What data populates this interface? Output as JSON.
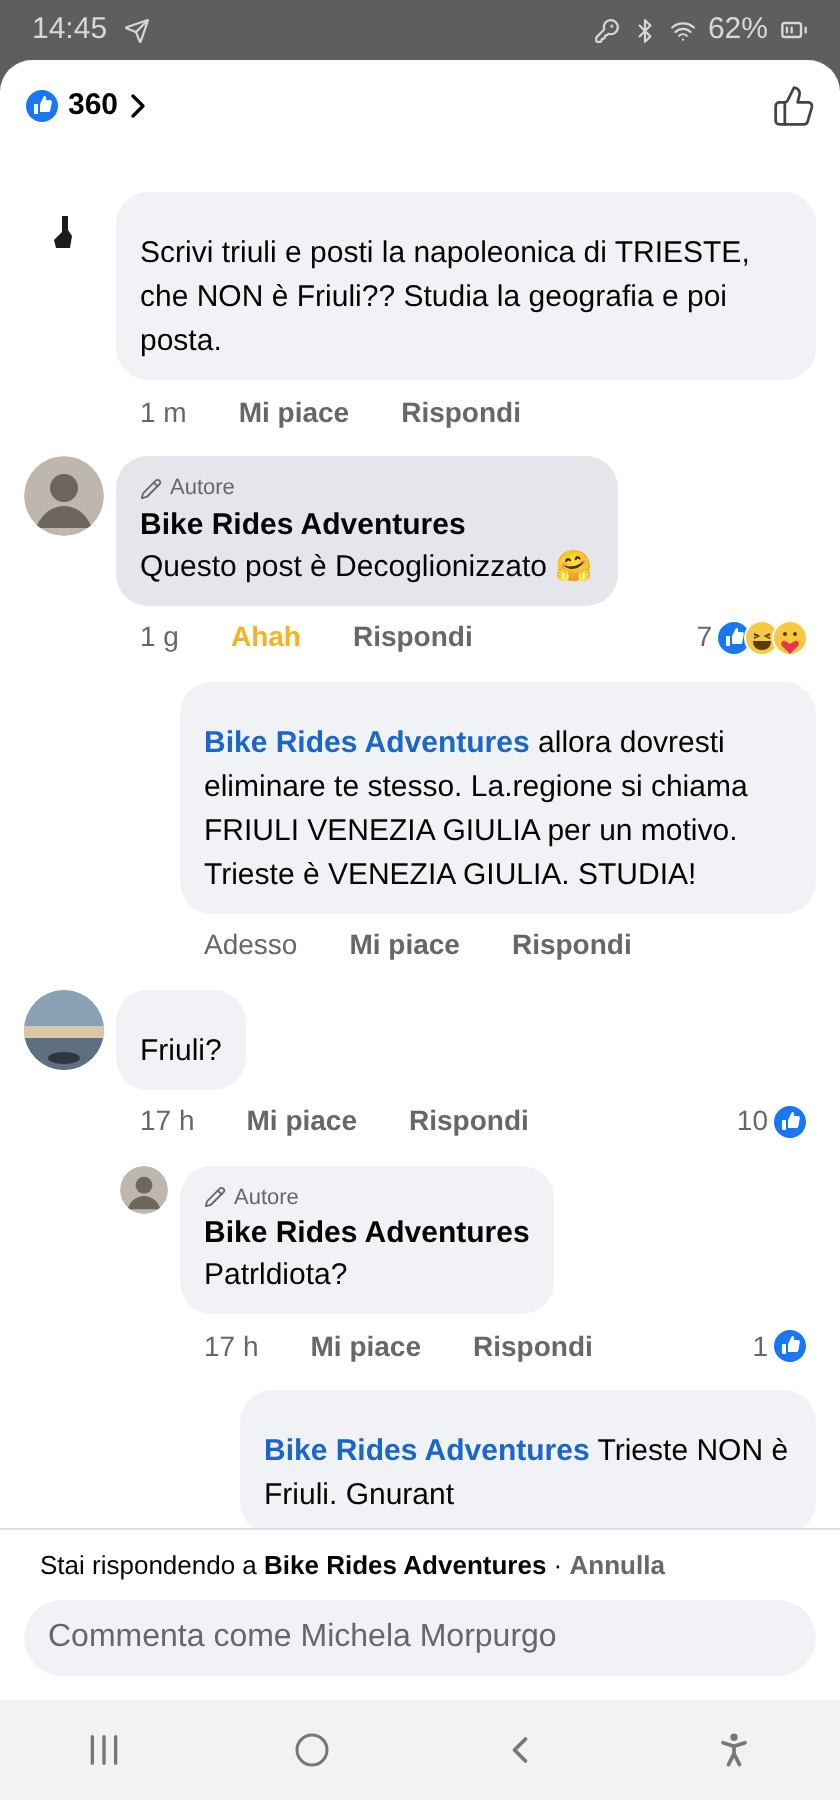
{
  "status_bar": {
    "time": "14:45",
    "battery": "62%"
  },
  "header": {
    "reaction_count": "360"
  },
  "comments": [
    {
      "avatar": {
        "kind": "silhouette"
      },
      "highlighted": false,
      "text": "Scrivi triuli e posti la napoleonica di TRIESTE, che NON è Friuli?? Studia la geografia e poi posta.",
      "time": "1 m",
      "like_label": "Mi piace",
      "reacted": false,
      "reply_label": "Rispondi"
    },
    {
      "avatar": {
        "kind": "person"
      },
      "highlighted": true,
      "badge": "Autore",
      "name": "Bike Rides Adventures",
      "text": "Questo post è Decoglionizzato 🤗",
      "time": "1 g",
      "like_label": "Ahah",
      "reacted": true,
      "reply_label": "Rispondi",
      "reaction_count": "7",
      "reactions": [
        {
          "kind": "like"
        },
        {
          "kind": "haha"
        },
        {
          "kind": "care"
        }
      ],
      "children": [
        {
          "highlighted": false,
          "mention": "Bike Rides Adventures",
          "text": "allora dovresti eliminare te stesso. La.regione si chiama FRIULI VENEZIA GIULIA per un motivo. Trieste è VENEZIA GIULIA. STUDIA!",
          "time": "Adesso",
          "like_label": "Mi piace",
          "reacted": false,
          "reply_label": "Rispondi"
        }
      ]
    },
    {
      "avatar": {
        "kind": "landscape"
      },
      "highlighted": false,
      "text": "Friuli?",
      "time": "17 h",
      "like_label": "Mi piace",
      "reacted": false,
      "reply_label": "Rispondi",
      "reaction_count": "10",
      "reactions": [
        {
          "kind": "like"
        }
      ],
      "children": [
        {
          "avatar": {
            "kind": "person"
          },
          "highlighted": false,
          "badge": "Autore",
          "name": "Bike Rides Adventures",
          "text": "Patrldiota?",
          "time": "17 h",
          "like_label": "Mi piace",
          "reacted": false,
          "reply_label": "Rispondi",
          "reaction_count": "1",
          "reactions": [
            {
              "kind": "like"
            }
          ],
          "children": [
            {
              "highlighted": false,
              "mention": "Bike Rides Adventures",
              "text": "Trieste NON è Friuli. Gnurant"
            }
          ]
        }
      ]
    }
  ],
  "composer": {
    "prefix": "Stai rispondendo a",
    "target": "Bike Rides Adventures",
    "separator": "·",
    "cancel": "Annulla",
    "placeholder": "Commenta come Michela Morpurgo"
  }
}
